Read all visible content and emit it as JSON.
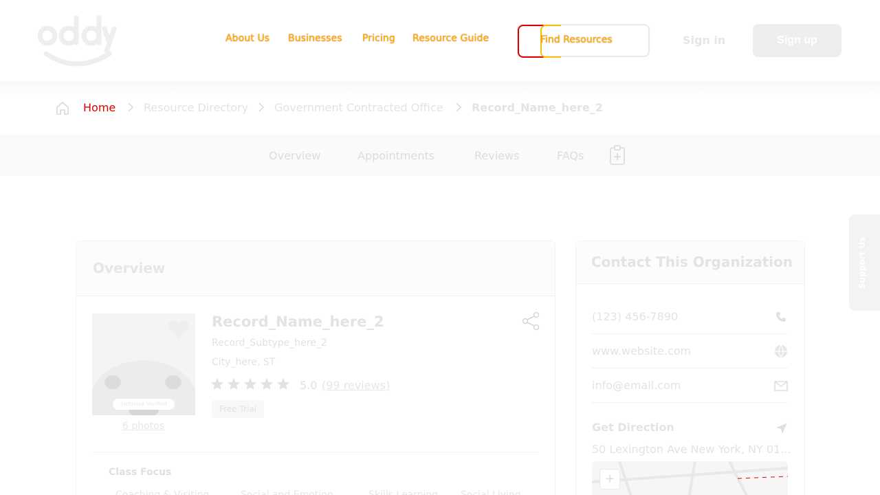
{
  "header": {
    "logo_text": "oddy",
    "nav": [
      "About Us",
      "Businesses",
      "Pricing",
      "Resource Guide"
    ],
    "find_label": "Find Resources",
    "signin_label": "Sign in",
    "signup_label": "Sign up"
  },
  "breadcrumb": {
    "items": [
      "Home",
      "Resource Directory",
      "Government Contracted Office",
      "Record_Name_here_2"
    ]
  },
  "tabs": [
    "Overview",
    "Appointments",
    "Reviews",
    "FAQs"
  ],
  "overview": {
    "title": "Overview",
    "photo_badge": "Inclusive Verified",
    "photos_link": "6 photos",
    "record_name": "Record_Name_here_2",
    "record_subtype": "Record_Subtype_here_2",
    "city": "City_here, ST",
    "rating_value": "5.0",
    "rating_stars": 5,
    "reviews_link": "(99 reviews)",
    "badge": "Free Trial",
    "class_focus_label": "Class Focus",
    "focus_items": [
      "Coaching & Visiting",
      "Social and Emotion",
      "Skills Learning",
      "Social Living"
    ]
  },
  "contact": {
    "title": "Contact This Organization",
    "phone": "(123) 456-7890",
    "website": "www.website.com",
    "email": "info@email.com",
    "direction_label": "Get Direction",
    "address": "50 Lexington Ave New York, NY 01..."
  },
  "support_label": "Support Us",
  "colors": {
    "nav_text": "#f2c200",
    "nav_outline": "#e00000",
    "signup_bg": "#eeeeee"
  }
}
